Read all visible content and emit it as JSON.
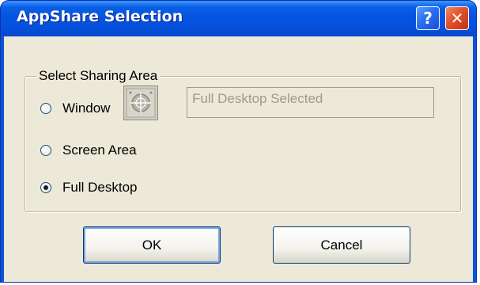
{
  "dialog": {
    "title": "AppShare Selection",
    "help_glyph": "?",
    "close_glyph": "✕"
  },
  "sharing_area": {
    "group_label": "Select Sharing Area",
    "options": [
      {
        "label": "Window",
        "checked": false
      },
      {
        "label": "Screen Area",
        "checked": false
      },
      {
        "label": "Full Desktop",
        "checked": true
      }
    ],
    "target_icon": "crosshair-target-icon",
    "selection_display": "Full Desktop Selected"
  },
  "buttons": {
    "ok_label": "OK",
    "cancel_label": "Cancel"
  },
  "colors": {
    "titlebar": "#0553e0",
    "client_background": "#ece9d8",
    "close_button": "#e0502a"
  }
}
